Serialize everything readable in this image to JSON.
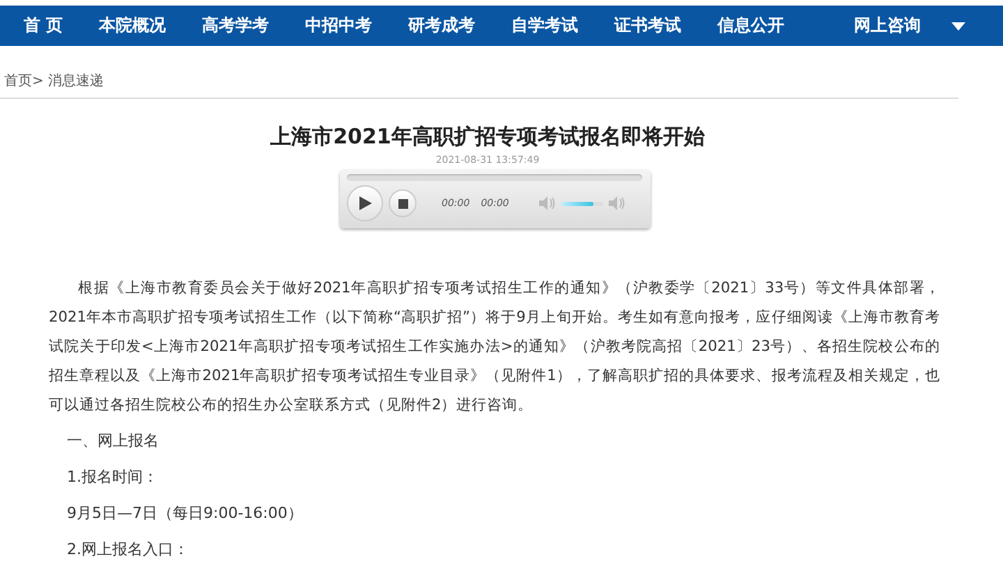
{
  "nav": {
    "items": [
      {
        "label": "首 页"
      },
      {
        "label": "本院概况"
      },
      {
        "label": "高考学考"
      },
      {
        "label": "中招中考"
      },
      {
        "label": "研考成考"
      },
      {
        "label": "自学考试"
      },
      {
        "label": "证书考试"
      },
      {
        "label": "信息公开"
      },
      {
        "label": "网上咨询"
      }
    ],
    "more_menu": true
  },
  "breadcrumb": [
    "首页>",
    "消息速递"
  ],
  "article": {
    "title": "上海市2021年高职扩招专项考试报名即将开始",
    "date": "2021-08-31 13:57:49",
    "audio_player": {
      "progress": {
        "level": 0
      },
      "elapsed": "00:00",
      "duration": "00:00",
      "volume": {
        "level": 0.75
      }
    },
    "paragraphs": [
      "根据《上海市教育委员会关于做好2021年高职扩招专项考试招生工作的通知》（沪教委学〔2021〕33号）等文件具体部署，2021年本市高职扩招专项考试招生工作（以下简称“高职扩招”）将于9月上旬开始。考生如有意向报考，应仔细阅读《上海市教育考试院关于印发<上海市2021年高职扩招专项考试招生工作实施办法>的通知》（沪教考院高招〔2021〕23号）、各招生院校公布的招生章程以及《上海市2021年高职扩招专项考试招生专业目录》（见附件1），了解高职扩招的具体要求、报考流程及相关规定，也可以通过各招生院校公布的招生办公室联系方式（见附件2）进行咨询。"
    ],
    "items": [
      "一、网上报名",
      "1.报名时间：",
      "9月5日—7日（每日9:00-16:00）",
      "2.网上报名入口："
    ]
  }
}
